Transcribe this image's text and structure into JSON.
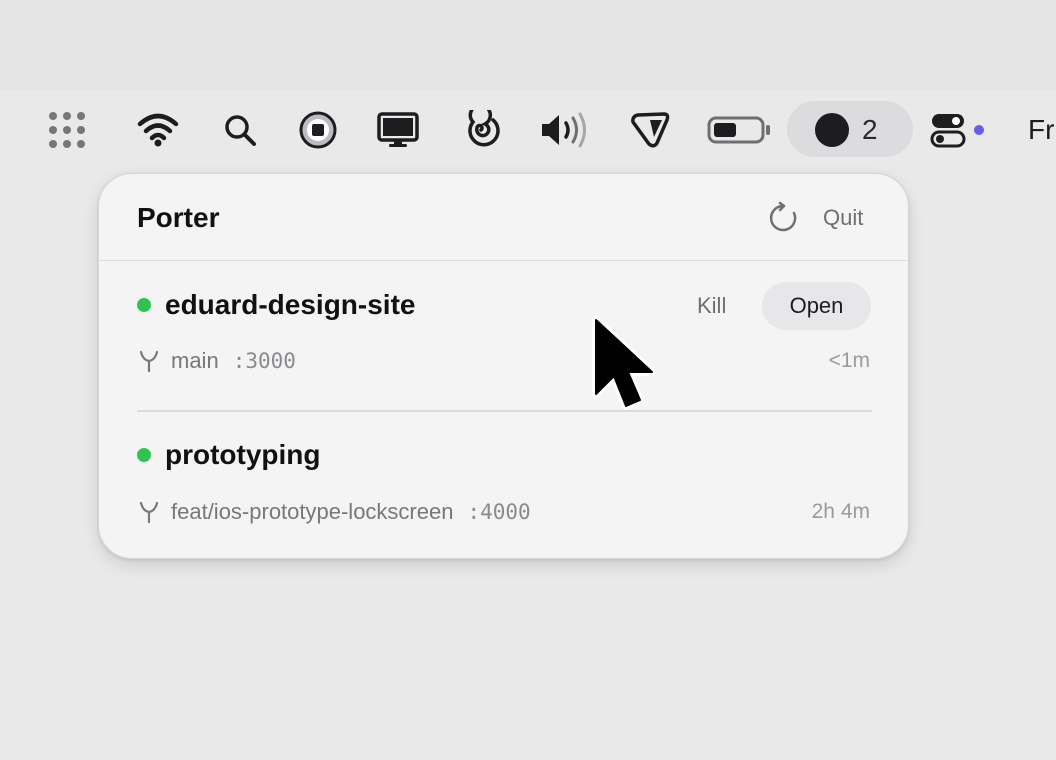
{
  "menubar": {
    "icons": [
      "grid-dots-icon",
      "wifi-icon",
      "search-icon",
      "record-stop-icon",
      "display-icon",
      "spiral-icon",
      "volume-icon",
      "tag-icon",
      "battery-icon",
      "control-center-icon"
    ],
    "status_item": {
      "count": "2"
    },
    "clock_text": "Fr"
  },
  "panel": {
    "title": "Porter",
    "quit_label": "Quit",
    "kill_label": "Kill",
    "open_label": "Open",
    "projects": [
      {
        "name": "eduard-design-site",
        "branch": "main",
        "port": ":3000",
        "uptime": "<1m",
        "status_color": "#2fc452"
      },
      {
        "name": "prototyping",
        "branch": "feat/ios-prototype-lockscreen",
        "port": ":4000",
        "uptime": "2h 4m",
        "status_color": "#2fc452"
      }
    ]
  },
  "colors": {
    "accent_dot": "#6b5cf0",
    "running": "#2fc452"
  }
}
